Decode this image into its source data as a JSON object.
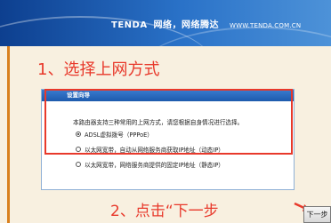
{
  "header": {
    "brand": "TENDA",
    "slogan": "网络，网络腾达",
    "url": "WWW.TENDA.COM.CN"
  },
  "annotations": {
    "step1": "1、选择上网方式",
    "step2": "2、点击“下一步"
  },
  "panel": {
    "title": "设置向导",
    "intro": "本路由器支持三种常用的上网方式，请您根据自身情况进行选择。",
    "options": [
      {
        "label": "ADSL虚拟拨号（PPPoE）",
        "selected": true
      },
      {
        "label": "以太网宽带，自动从网络服务商获取IP地址（动态IP）",
        "selected": false
      },
      {
        "label": "以太网宽带，网络服务商提供的固定IP地址（静态IP）",
        "selected": false
      }
    ]
  },
  "buttons": {
    "next": "下一步"
  },
  "colors": {
    "header_blue": "#1d5aad",
    "annotation_red": "#e8392b",
    "side_orange": "#d9801e"
  }
}
